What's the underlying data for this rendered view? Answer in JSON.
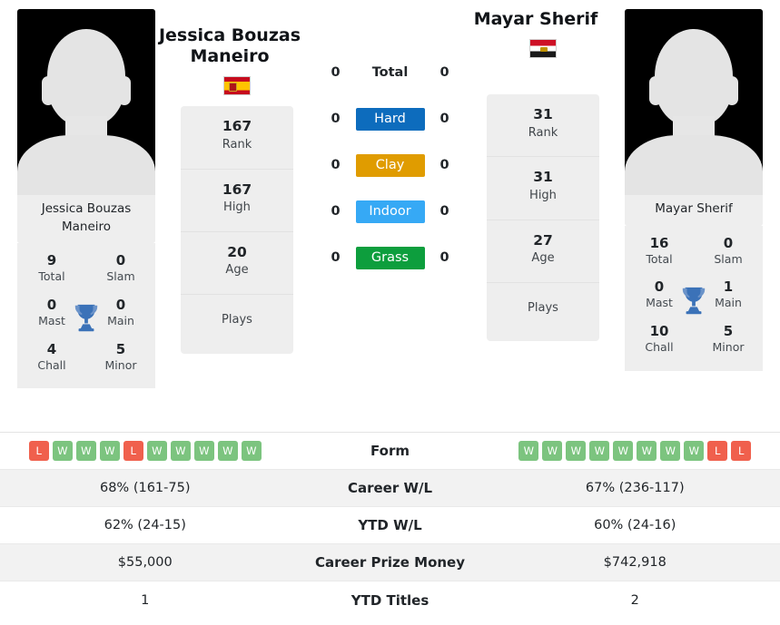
{
  "players": {
    "left": {
      "name": "Jessica Bouzas Maneiro",
      "photo_caption": "Jessica Bouzas Maneiro",
      "flag": "flag-spain",
      "stats": [
        {
          "value": "167",
          "label": "Rank"
        },
        {
          "value": "167",
          "label": "High"
        },
        {
          "value": "20",
          "label": "Age"
        },
        {
          "value": "",
          "label": "Plays"
        }
      ],
      "titles": [
        {
          "value": "9",
          "label": "Total"
        },
        {
          "value": "0",
          "label": "Slam"
        },
        {
          "value": "0",
          "label": "Mast"
        },
        {
          "value": "0",
          "label": "Main"
        },
        {
          "value": "4",
          "label": "Chall"
        },
        {
          "value": "5",
          "label": "Minor"
        }
      ],
      "form": [
        "L",
        "W",
        "W",
        "W",
        "L",
        "W",
        "W",
        "W",
        "W",
        "W"
      ],
      "career_wl": "68% (161-75)",
      "ytd_wl": "62% (24-15)",
      "career_prize_money": "$55,000",
      "ytd_titles": "1"
    },
    "right": {
      "name": "Mayar Sherif",
      "photo_caption": "Mayar Sherif",
      "flag": "flag-egypt",
      "stats": [
        {
          "value": "31",
          "label": "Rank"
        },
        {
          "value": "31",
          "label": "High"
        },
        {
          "value": "27",
          "label": "Age"
        },
        {
          "value": "",
          "label": "Plays"
        }
      ],
      "titles": [
        {
          "value": "16",
          "label": "Total"
        },
        {
          "value": "0",
          "label": "Slam"
        },
        {
          "value": "0",
          "label": "Mast"
        },
        {
          "value": "1",
          "label": "Main"
        },
        {
          "value": "10",
          "label": "Chall"
        },
        {
          "value": "5",
          "label": "Minor"
        }
      ],
      "form": [
        "W",
        "W",
        "W",
        "W",
        "W",
        "W",
        "W",
        "W",
        "L",
        "L"
      ],
      "career_wl": "67% (236-117)",
      "ytd_wl": "60% (24-16)",
      "career_prize_money": "$742,918",
      "ytd_titles": "2"
    }
  },
  "surfaces": [
    {
      "label": "Total",
      "left": "0",
      "right": "0",
      "color": "transparent",
      "plain": true
    },
    {
      "label": "Hard",
      "left": "0",
      "right": "0",
      "color": "#0d6cbd",
      "plain": false
    },
    {
      "label": "Clay",
      "left": "0",
      "right": "0",
      "color": "#e09c00",
      "plain": false
    },
    {
      "label": "Indoor",
      "left": "0",
      "right": "0",
      "color": "#36a9f5",
      "plain": false
    },
    {
      "label": "Grass",
      "left": "0",
      "right": "0",
      "color": "#0d9e3d",
      "plain": false
    }
  ],
  "table_rows": [
    {
      "label": "Form",
      "type": "form"
    },
    {
      "label": "Career W/L",
      "type": "text",
      "key": "career_wl"
    },
    {
      "label": "YTD W/L",
      "type": "text",
      "key": "ytd_wl"
    },
    {
      "label": "Career Prize Money",
      "type": "text",
      "key": "career_prize_money"
    },
    {
      "label": "YTD Titles",
      "type": "text",
      "key": "ytd_titles"
    }
  ],
  "colors": {
    "hard": "#0d6cbd",
    "clay": "#e09c00",
    "indoor": "#36a9f5",
    "grass": "#0d9e3d",
    "win": "#7cc47f",
    "loss": "#f0604d",
    "trophy": "#3b72b8"
  }
}
